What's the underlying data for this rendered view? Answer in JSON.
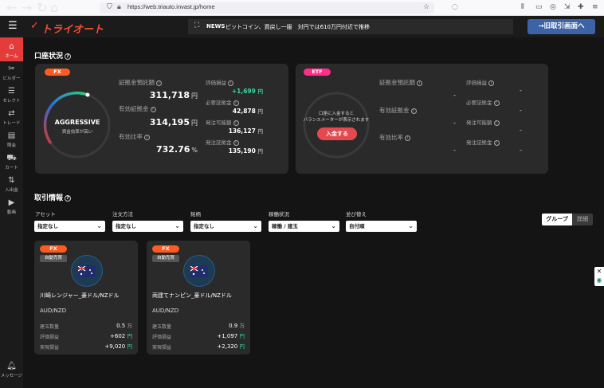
{
  "browser": {
    "url": "https://web.triauto.invast.jp/home",
    "nav_back": "←",
    "nav_forward": "→",
    "reload": "↻",
    "home": "⌂"
  },
  "header": {
    "logo": "トライオート",
    "news_label": "NEWS",
    "news_text": "ビットコイン、買戻し一服　対円では610万円付近で推移",
    "old_screen_button": "→旧取引画面へ"
  },
  "sidebar": {
    "items": [
      {
        "label": "ホーム",
        "icon": "home-icon"
      },
      {
        "label": "ビルダー",
        "icon": "tools-icon"
      },
      {
        "label": "セレクト",
        "icon": "select-icon"
      },
      {
        "label": "トレード",
        "icon": "trade-icon"
      },
      {
        "label": "照会",
        "icon": "inquiry-icon"
      },
      {
        "label": "カート",
        "icon": "cart-icon"
      },
      {
        "label": "入出金",
        "icon": "transfer-icon"
      },
      {
        "label": "動画",
        "icon": "video-icon"
      },
      {
        "label": "メッセージ",
        "icon": "bell-icon"
      }
    ]
  },
  "account": {
    "title": "口座状況",
    "fx": {
      "tag": "FX",
      "gauge_label": "AGGRESSIVE",
      "gauge_sub": "資金効率が高い",
      "deposit_label": "証拠金預託額",
      "deposit_value": "311,718",
      "effective_label": "有効証拠金",
      "effective_value": "314,195",
      "ratio_label": "有効比率",
      "ratio_value": "732.76",
      "ratio_unit": "%",
      "yen": "円",
      "pl_label": "評価損益",
      "pl_value": "+1,699",
      "required_label": "必要証拠金",
      "required_value": "42,878",
      "orderable_label": "発注可能額",
      "orderable_value": "136,127",
      "order_margin_label": "発注証拠金",
      "order_margin_value": "135,190"
    },
    "etf": {
      "tag": "ETF",
      "gauge_msg_1": "口座に入金すると",
      "gauge_msg_2": "バランスメーターが表示されます",
      "deposit_button": "入金する",
      "deposit_label": "証拠金預託額",
      "effective_label": "有効証拠金",
      "ratio_label": "有効比率",
      "pl_label": "評価損益",
      "required_label": "必要証拠金",
      "orderable_label": "発注可能額",
      "order_margin_label": "発注証拠金",
      "dash": "-"
    }
  },
  "trading": {
    "title": "取引情報",
    "filters": [
      {
        "label": "アセット",
        "value": "指定なし"
      },
      {
        "label": "注文方法",
        "value": "指定なし"
      },
      {
        "label": "銘柄",
        "value": "指定なし"
      },
      {
        "label": "稼働状況",
        "value": "稼働 / 建玉"
      },
      {
        "label": "並び替え",
        "value": "自付順"
      }
    ],
    "view_group": "グループ",
    "view_detail": "詳細",
    "cards": [
      {
        "tag": "FX",
        "type": "自動売買",
        "name": "川崎レンジャー_豪ドル/NZドル",
        "pair": "AUD/NZD",
        "position_label": "建玉数量",
        "position_value": "0.5",
        "position_unit": "万",
        "pl_label": "評価損益",
        "pl_value": "+602",
        "realized_label": "実現損益",
        "realized_value": "+9,020",
        "yen": "円"
      },
      {
        "tag": "FX",
        "type": "自動売買",
        "name": "両建てナンピン_豪ドル/NZドル",
        "pair": "AUD/NZD",
        "position_label": "建玉数量",
        "position_value": "0.9",
        "position_unit": "万",
        "pl_label": "評価損益",
        "pl_value": "+1,097",
        "realized_label": "実現損益",
        "realized_value": "+2,320",
        "yen": "円"
      }
    ]
  },
  "colors": {
    "accent_red": "#e43b3b",
    "fx_tag": "#ff5a1f",
    "etf_tag": "#ff2e8a",
    "positive": "#37d7a1",
    "button_blue": "#3d63a7"
  }
}
